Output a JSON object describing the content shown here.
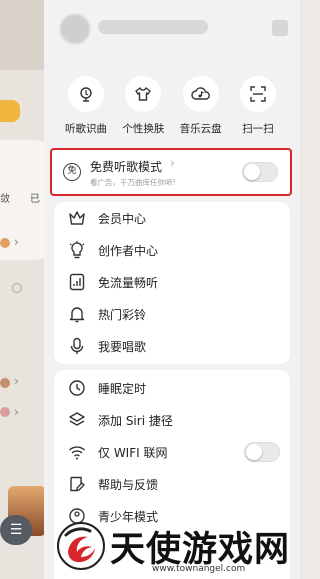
{
  "background": {
    "chars": [
      "敛",
      "已"
    ],
    "pill_icon": "menu-lines-icon"
  },
  "drawer": {
    "quick_actions": [
      {
        "label": "听歌识曲",
        "icon": "music-recognition-icon"
      },
      {
        "label": "个性换肤",
        "icon": "tshirt-icon"
      },
      {
        "label": "音乐云盘",
        "icon": "cloud-music-icon"
      },
      {
        "label": "扫一扫",
        "icon": "scan-icon"
      }
    ],
    "free_mode": {
      "badge": "免",
      "title": "免费听歌模式",
      "chevron": "›",
      "subtitle": "看广告，千万曲库任你听!",
      "enabled": false
    },
    "menu": [
      {
        "label": "会员中心",
        "icon": "crown-icon"
      },
      {
        "label": "创作者中心",
        "icon": "lightbulb-icon"
      },
      {
        "label": "免流量畅听",
        "icon": "signal-bars-icon"
      },
      {
        "label": "热门彩铃",
        "icon": "bell-icon"
      },
      {
        "label": "我要唱歌",
        "icon": "microphone-icon"
      }
    ],
    "settings": [
      {
        "label": "睡眠定时",
        "icon": "clock-icon"
      },
      {
        "label": "添加 Siri 捷径",
        "icon": "layers-icon"
      },
      {
        "label": "仅 WIFI 联网",
        "icon": "wifi-icon",
        "toggle": false
      },
      {
        "label": "帮助与反馈",
        "icon": "feedback-icon"
      },
      {
        "label": "青少年模式",
        "icon": "teen-mode-icon"
      }
    ]
  },
  "watermark": {
    "text": "天使游戏网",
    "url": "www.townangel.com"
  },
  "colors": {
    "highlight_border": "#d8262d",
    "drawer_bg": "#f2f2f2"
  }
}
